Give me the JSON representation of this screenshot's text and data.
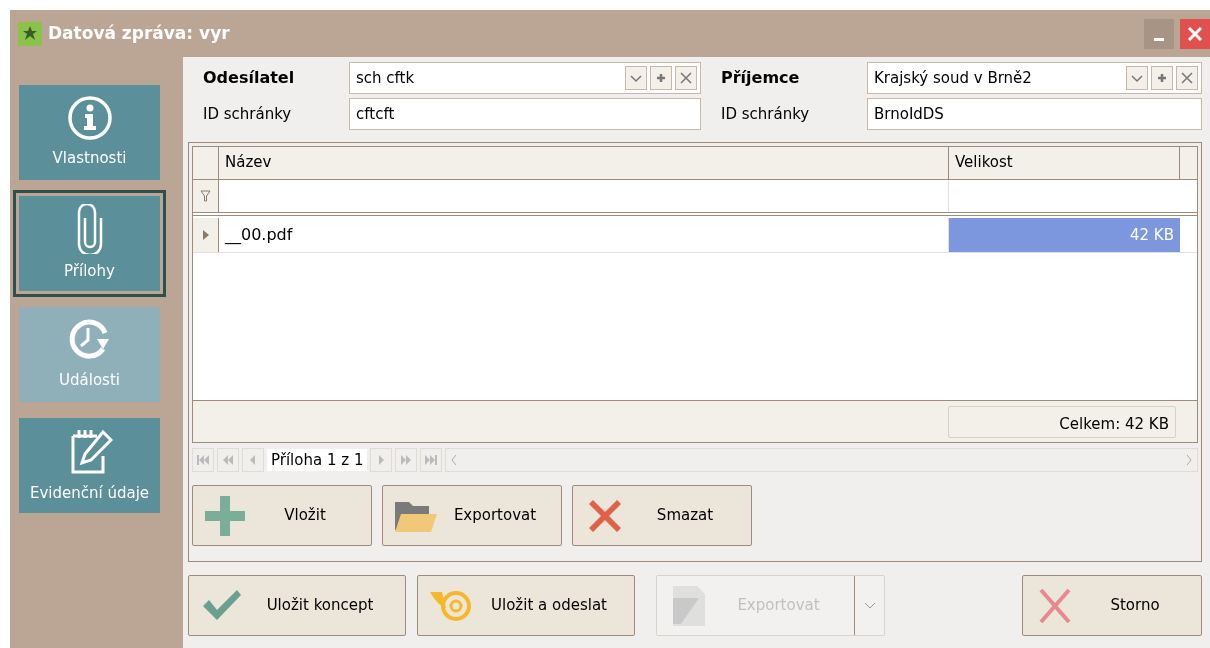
{
  "window": {
    "title": "Datová zpráva: vyr"
  },
  "sidebar": {
    "items": [
      {
        "label": "Vlastnosti",
        "kind": "info",
        "selected": false,
        "disabled": false
      },
      {
        "label": "Přílohy",
        "kind": "clip",
        "selected": true,
        "disabled": false
      },
      {
        "label": "Události",
        "kind": "clock",
        "selected": false,
        "disabled": true
      },
      {
        "label": "Evidenční údaje",
        "kind": "note",
        "selected": false,
        "disabled": false
      }
    ]
  },
  "sender": {
    "label": "Odesílatel",
    "value": "sch cftk",
    "id_label": "ID schránky",
    "id_value": "cftcft"
  },
  "recipient": {
    "label": "Příjemce",
    "value": "Krajský soud v Brně2",
    "id_label": "ID schránky",
    "id_value": "BrnoIdDS"
  },
  "table": {
    "columns": [
      "Název",
      "Velikost"
    ],
    "rows": [
      {
        "name": "__00.pdf",
        "size": "42 KB",
        "selected": true
      }
    ],
    "total": "Celkem: 42 KB",
    "navigator": "Příloha 1 z 1"
  },
  "attachment_buttons": [
    {
      "label": "Vložit",
      "kind": "add"
    },
    {
      "label": "Exportovat",
      "kind": "folder"
    },
    {
      "label": "Smazat",
      "kind": "delete"
    }
  ],
  "footer_buttons": [
    {
      "label": "Uložit koncept",
      "kind": "check",
      "disabled": false
    },
    {
      "label": "Uložit a odeslat",
      "kind": "mail",
      "disabled": false
    },
    {
      "label": "Exportovat",
      "kind": "export",
      "disabled": true
    },
    {
      "label": "Storno",
      "kind": "cancel",
      "disabled": false
    }
  ]
}
